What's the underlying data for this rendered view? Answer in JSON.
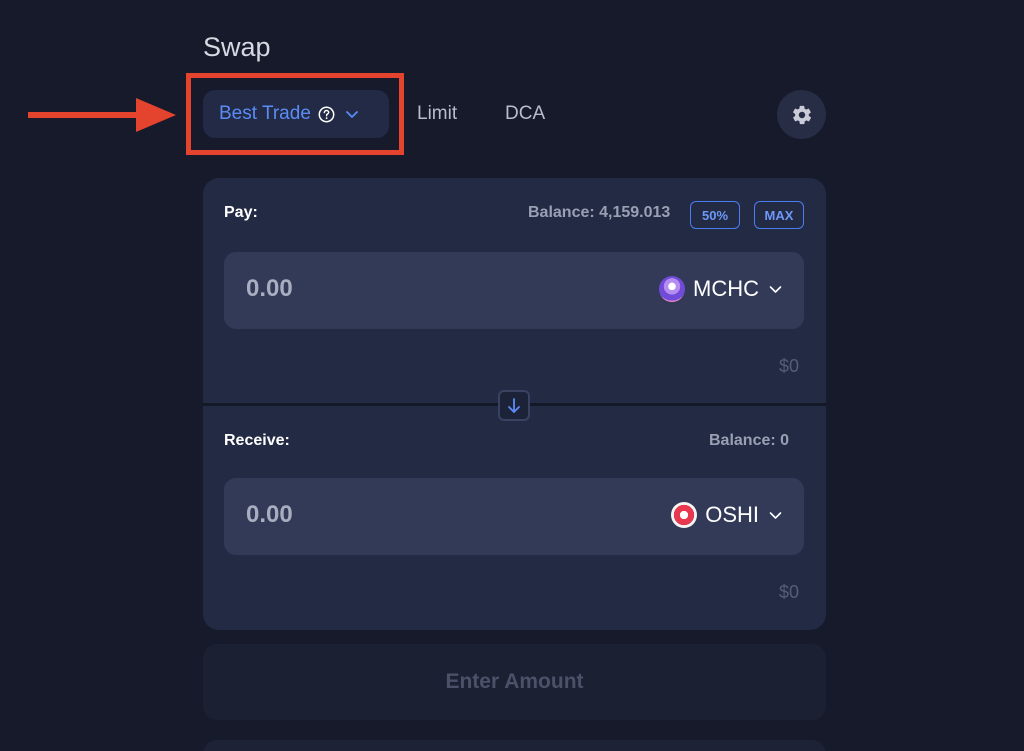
{
  "page": {
    "title": "Swap"
  },
  "modes": {
    "best_trade": "Best Trade",
    "limit": "Limit",
    "dca": "DCA"
  },
  "pay": {
    "label": "Pay:",
    "balance": "Balance: 4,159.013",
    "pct_50": "50%",
    "max": "MAX",
    "amount_placeholder": "0.00",
    "token": "MCHC",
    "usd": "$0"
  },
  "receive": {
    "label": "Receive:",
    "balance": "Balance: 0",
    "amount_placeholder": "0.00",
    "token": "OSHI",
    "usd": "$0"
  },
  "action": {
    "label": "Enter Amount"
  },
  "icons": {
    "annotation": "red-arrow-icon",
    "help": "question-circle-icon",
    "chevron": "chevron-down-icon",
    "settings": "gear-icon",
    "flip": "arrow-down-icon",
    "pay_token": "mchc-token-icon",
    "receive_token": "oshi-token-icon"
  },
  "colors": {
    "background": "#161a2b",
    "card": "#232a43",
    "input": "#323a58",
    "accent": "#5b8cf6",
    "annotation": "#e4432d"
  }
}
